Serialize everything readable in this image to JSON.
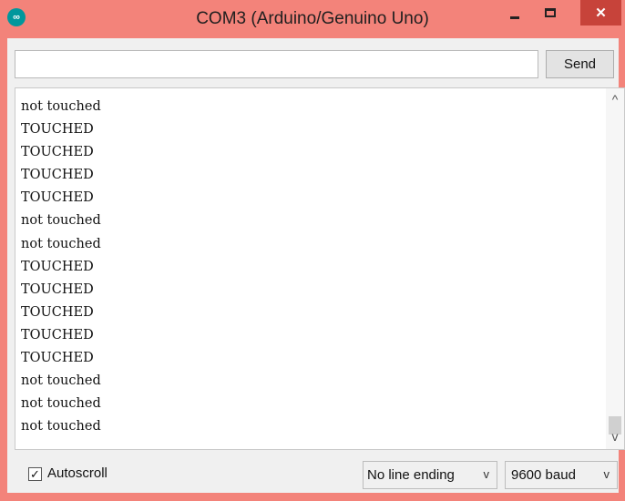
{
  "window": {
    "title": "COM3 (Arduino/Genuino Uno)",
    "app_icon_glyph": "∞",
    "minimize_glyph": "",
    "close_glyph": "✕"
  },
  "input_bar": {
    "value": "",
    "send_label": "Send"
  },
  "output_lines": [
    "not touched",
    "TOUCHED",
    "TOUCHED",
    "TOUCHED",
    "TOUCHED",
    "not touched",
    "not touched",
    "TOUCHED",
    "TOUCHED",
    "TOUCHED",
    "TOUCHED",
    "TOUCHED",
    "not touched",
    "not touched",
    "not touched"
  ],
  "scrollbar": {
    "up_glyph": "^",
    "down_glyph": "v"
  },
  "footer": {
    "autoscroll_label": "Autoscroll",
    "autoscroll_checked": true,
    "check_glyph": "✓",
    "line_ending": "No line ending",
    "baud_rate": "9600 baud",
    "dropdown_arrow": "v"
  },
  "colors": {
    "titlebar": "#f3837a",
    "close_button": "#c7433a",
    "arduino_teal": "#00979c"
  }
}
